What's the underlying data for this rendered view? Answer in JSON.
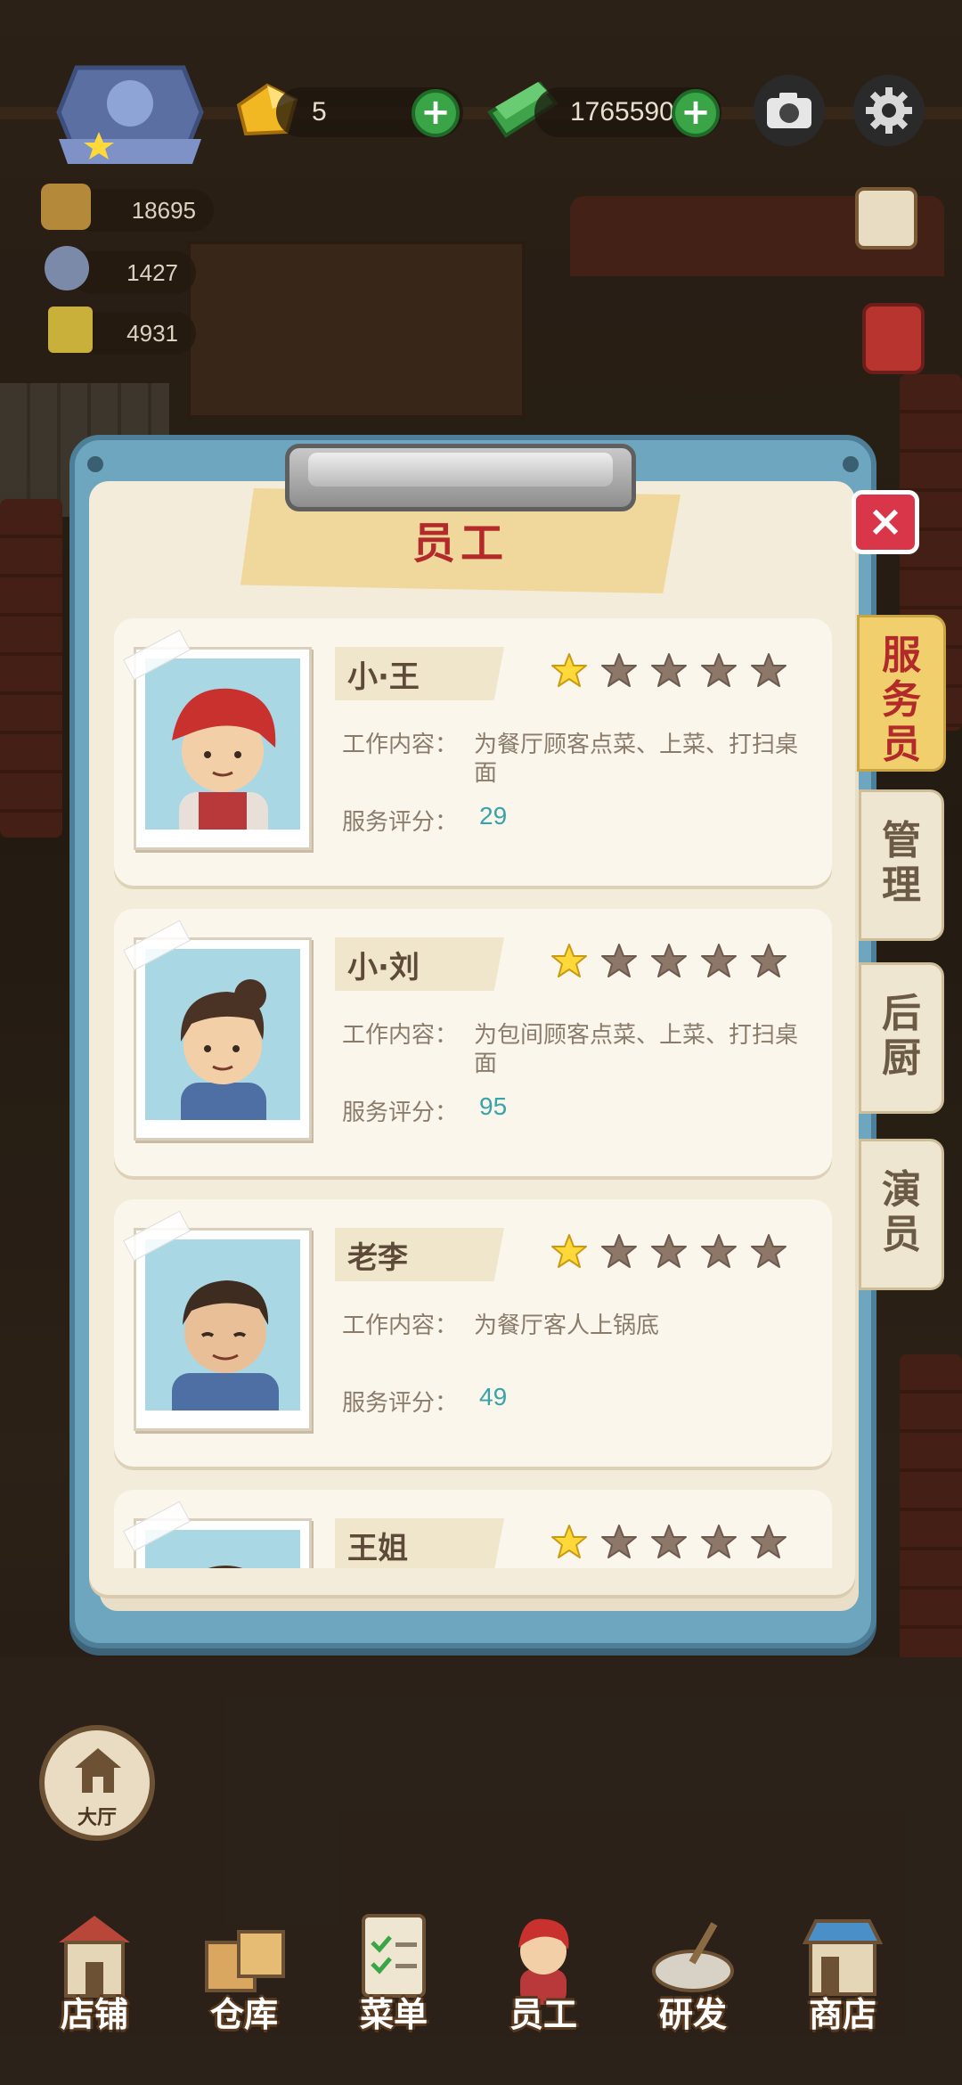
{
  "hud": {
    "gold_value": "5",
    "cash_value": "1765590",
    "stat_1": "18695",
    "stat_2": "1427",
    "stat_3": "4931"
  },
  "modal": {
    "title": "员工",
    "close_label": "×",
    "tabs": [
      {
        "label": "服务员",
        "chars": [
          "服",
          "务",
          "员"
        ],
        "active": true
      },
      {
        "label": "管理",
        "chars": [
          "管",
          "理"
        ],
        "active": false
      },
      {
        "label": "后厨",
        "chars": [
          "后",
          "厨"
        ],
        "active": false
      },
      {
        "label": "演员",
        "chars": [
          "演",
          "员"
        ],
        "active": false
      }
    ],
    "field_labels": {
      "work": "工作内容：",
      "score": "服务评分："
    },
    "staff": [
      {
        "name": "小·王",
        "rating": 1,
        "max_rating": 5,
        "work": "为餐厅顾客点菜、上菜、打扫桌面",
        "score": "29"
      },
      {
        "name": "小·刘",
        "rating": 1,
        "max_rating": 5,
        "work": "为包间顾客点菜、上菜、打扫桌面",
        "score": "95"
      },
      {
        "name": "老李",
        "rating": 1,
        "max_rating": 5,
        "work": "为餐厅客人上锅底",
        "score": "49"
      },
      {
        "name": "王姐",
        "rating": 1,
        "max_rating": 5,
        "work": "",
        "score": ""
      }
    ]
  },
  "hall_button": "大厅",
  "nav": [
    "店铺",
    "仓库",
    "菜单",
    "员工",
    "研发",
    "商店"
  ],
  "colors": {
    "panel_frame": "#6fa6bf",
    "title_text": "#b22a2a",
    "active_tab": "#f2cf6d",
    "score_value": "#38a3a8",
    "star_filled": "#ffd83a",
    "star_empty": "#8d7768"
  },
  "icons": [
    "chef-badge-icon",
    "gold-ingot-icon",
    "cash-stack-icon",
    "camera-icon",
    "gear-icon",
    "plus-icon",
    "close-icon",
    "star-icon",
    "house-icon"
  ]
}
